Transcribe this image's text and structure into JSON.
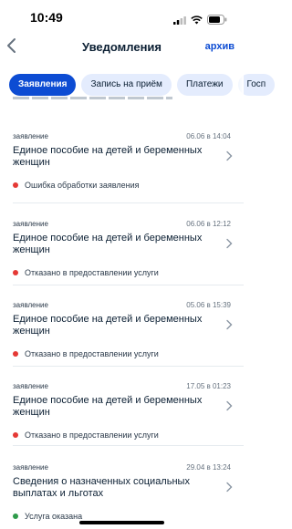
{
  "status_bar": {
    "time": "10:49"
  },
  "header": {
    "title": "Уведомления",
    "archive_label": "архив"
  },
  "tabs": [
    {
      "label": "Заявления",
      "active": true
    },
    {
      "label": "Запись на приём",
      "active": false
    },
    {
      "label": "Платежи",
      "active": false
    },
    {
      "label": "Госп",
      "active": false
    }
  ],
  "cards": [
    {
      "type": "заявление",
      "date": "06.06 в 14:04",
      "title": "Единое пособие на детей и беременных женщин",
      "status": "Ошибка обработки заявления",
      "status_color": "#e53935"
    },
    {
      "type": "заявление",
      "date": "06.06 в 12:12",
      "title": "Единое пособие на детей и беременных женщин",
      "status": "Отказано в предоставлении услуги",
      "status_color": "#e53935"
    },
    {
      "type": "заявление",
      "date": "05.06 в 15:39",
      "title": "Единое пособие на детей и беременных женщин",
      "status": "Отказано в предоставлении услуги",
      "status_color": "#e53935"
    },
    {
      "type": "заявление",
      "date": "17.05 в 01:23",
      "title": "Единое пособие на детей и беременных женщин",
      "status": "Отказано в предоставлении услуги",
      "status_color": "#e53935"
    },
    {
      "type": "заявление",
      "date": "29.04 в 13:24",
      "title": "Сведения о назначенных социальных выплатах и льготах",
      "status": "Услуга оказана",
      "status_color": "#2e9b4a"
    }
  ],
  "colors": {
    "accent": "#0d4cd3",
    "error": "#e53935",
    "success": "#2e9b4a"
  }
}
